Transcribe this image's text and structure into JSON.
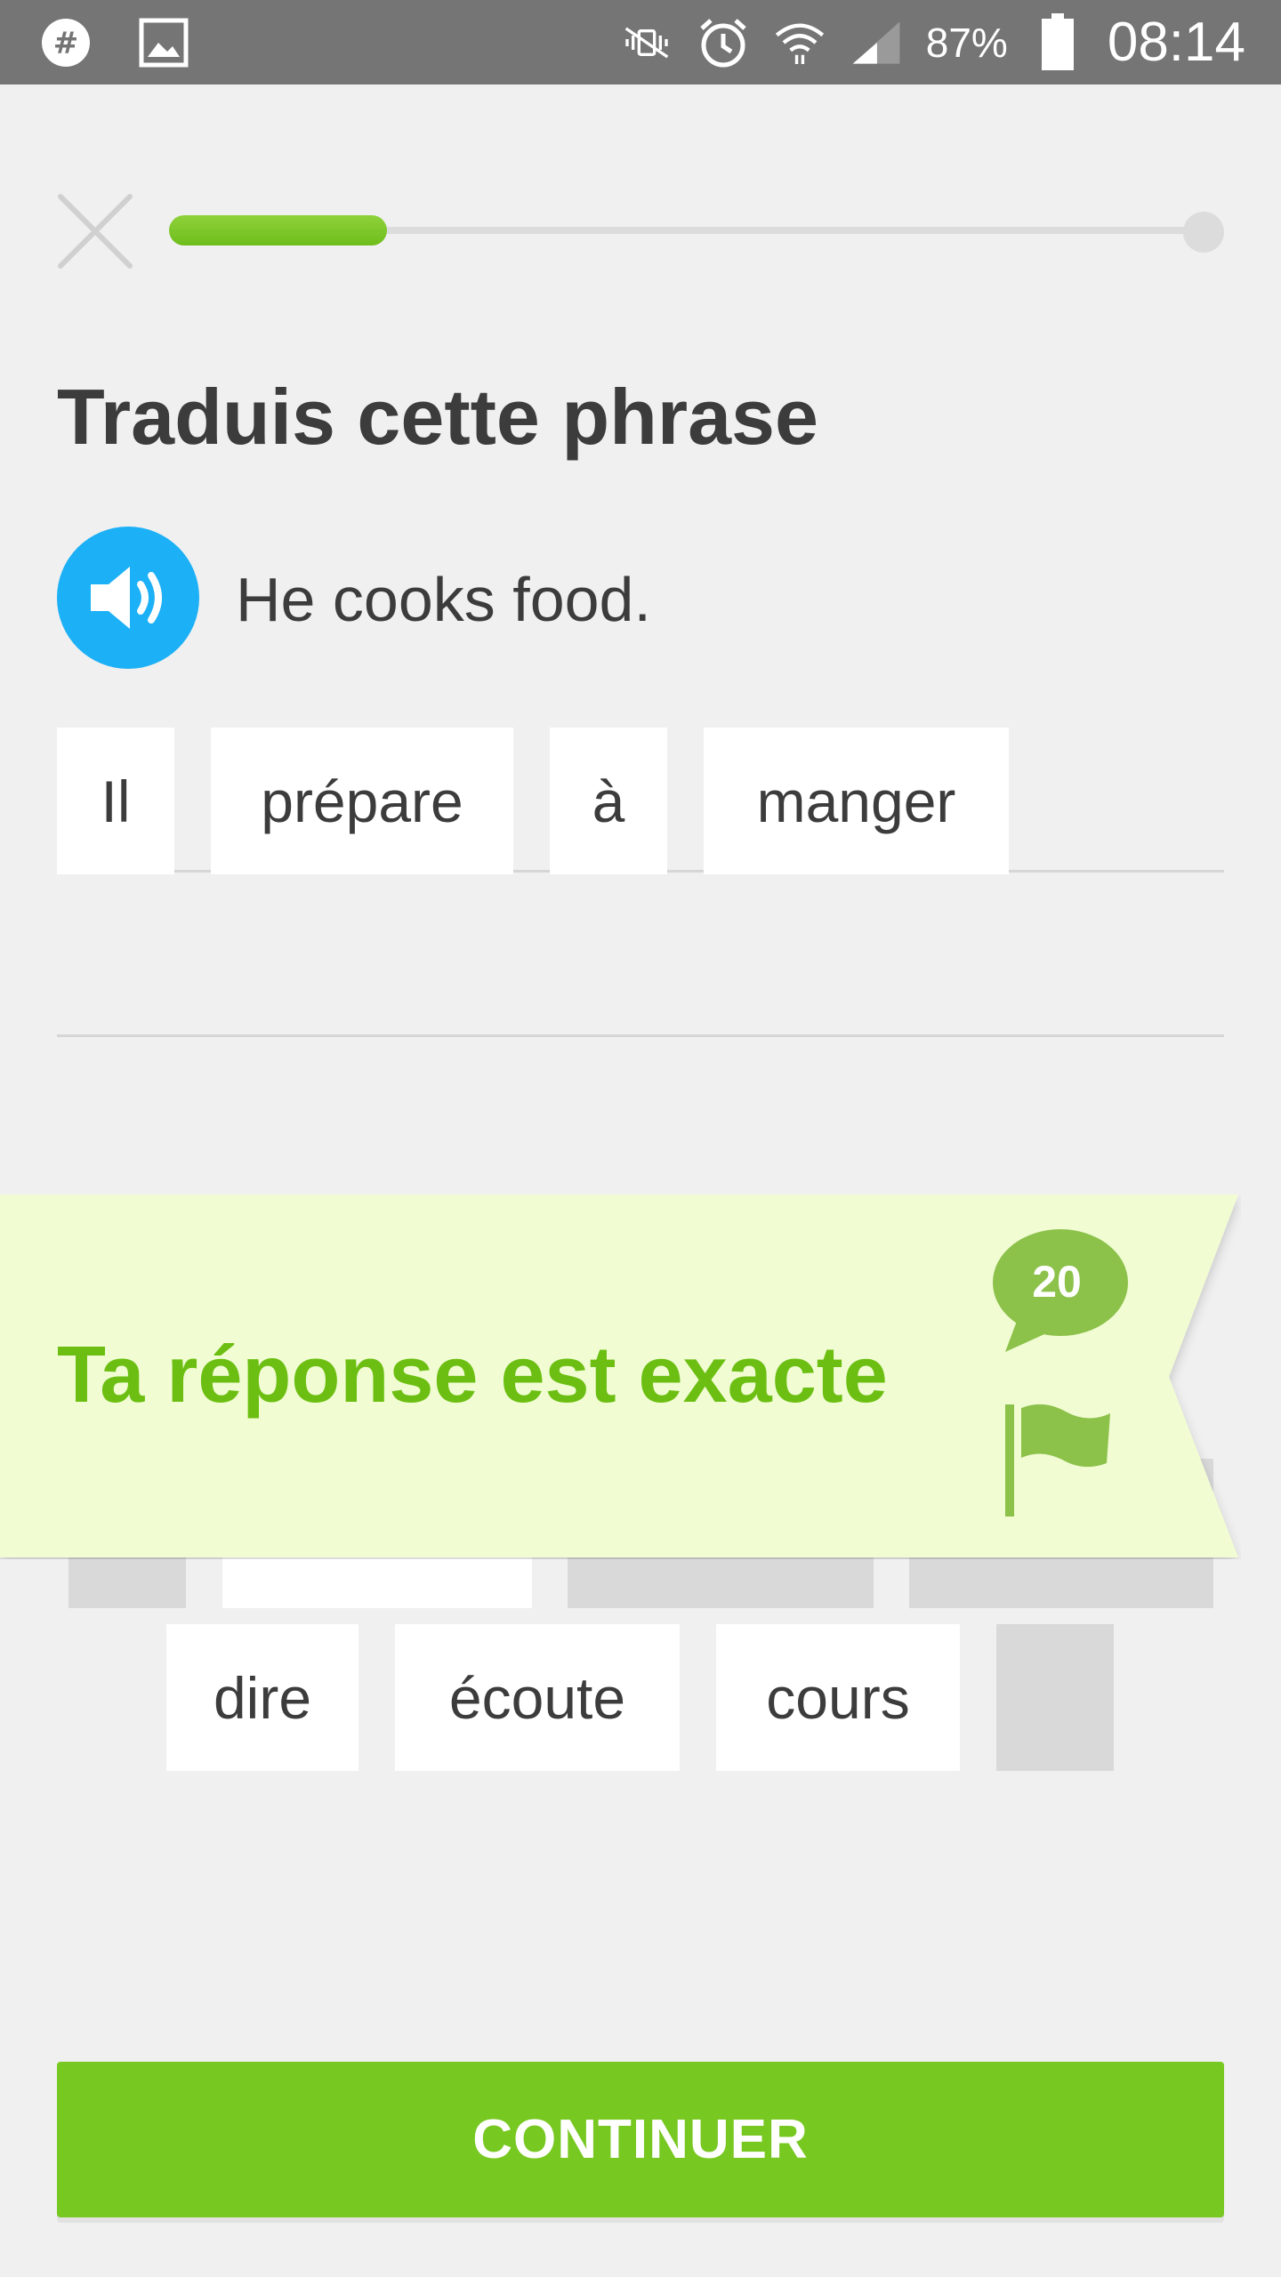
{
  "status_bar": {
    "icons_left": [
      "slack-icon",
      "gallery-icon"
    ],
    "icons_right": [
      "mute-vibrate-icon",
      "alarm-icon",
      "wifi-icon",
      "signal-icon"
    ],
    "battery": "87%",
    "time": "08:14"
  },
  "lesson": {
    "progress_fraction": 0.21,
    "title": "Traduis cette phrase",
    "prompt": "He cooks food."
  },
  "answer_tiles": [
    {
      "label": "Il"
    },
    {
      "label": "prépare"
    },
    {
      "label": "à"
    },
    {
      "label": "manger"
    }
  ],
  "word_bank": [
    {
      "label": "dire"
    },
    {
      "label": "écoute"
    },
    {
      "label": "cours"
    }
  ],
  "feedback": {
    "message": "Ta réponse est exacte",
    "comment_count": "20"
  },
  "continue_label": "CONTINUER",
  "colors": {
    "accent_green": "#78c822",
    "feedback_text": "#6cbf12",
    "banner_bg": "#f1fcd3",
    "speaker_blue": "#1cb0f6"
  }
}
